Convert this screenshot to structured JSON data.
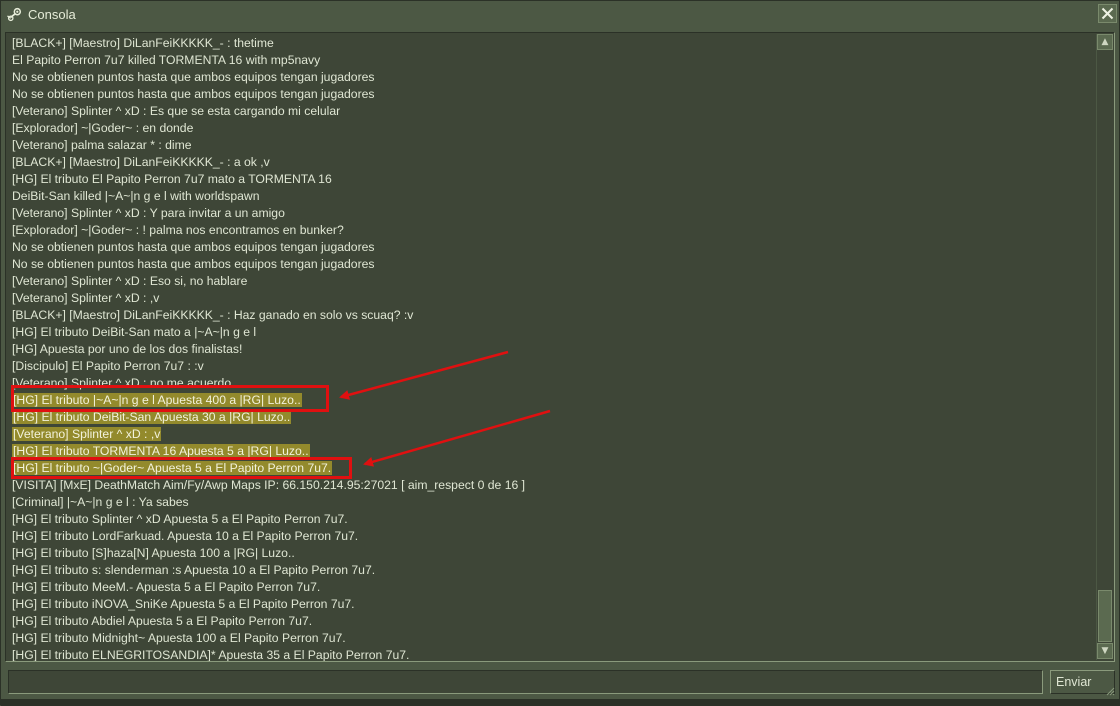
{
  "window": {
    "title": "Consola",
    "close_glyph": "✕"
  },
  "console": {
    "lines": [
      {
        "text": "[BLACK+] [Maestro] DiLanFeiKKKKK_- : thetime",
        "hl": false
      },
      {
        "text": "El Papito Perron 7u7 killed TORMENTA 16 with mp5navy",
        "hl": false
      },
      {
        "text": "No se obtienen puntos hasta que ambos equipos tengan jugadores",
        "hl": false
      },
      {
        "text": "No se obtienen puntos hasta que ambos equipos tengan jugadores",
        "hl": false
      },
      {
        "text": "[Veterano] Splinter ^ xD : Es que se esta cargando mi celular",
        "hl": false
      },
      {
        "text": "[Explorador] ~|Goder~ : en donde",
        "hl": false
      },
      {
        "text": "[Veterano] palma salazar * : dime",
        "hl": false
      },
      {
        "text": "[BLACK+] [Maestro] DiLanFeiKKKKK_- : a ok ,v",
        "hl": false
      },
      {
        "text": "[HG] El tributo El Papito Perron 7u7 mato a TORMENTA 16",
        "hl": false
      },
      {
        "text": "DeiBit-San killed |~A~|n g e l with worldspawn",
        "hl": false
      },
      {
        "text": "[Veterano] Splinter ^ xD : Y para invitar a un amigo",
        "hl": false
      },
      {
        "text": "[Explorador] ~|Goder~ : ! palma nos encontramos en bunker?",
        "hl": false
      },
      {
        "text": "No se obtienen puntos hasta que ambos equipos tengan jugadores",
        "hl": false
      },
      {
        "text": "No se obtienen puntos hasta que ambos equipos tengan jugadores",
        "hl": false
      },
      {
        "text": "[Veterano] Splinter ^ xD : Eso si, no hablare",
        "hl": false
      },
      {
        "text": "[Veterano] Splinter ^ xD : ,v",
        "hl": false
      },
      {
        "text": "[BLACK+] [Maestro] DiLanFeiKKKKK_- : Haz ganado en solo vs scuaq? :v",
        "hl": false
      },
      {
        "text": "[HG] El tributo DeiBit-San mato a |~A~|n g e l",
        "hl": false
      },
      {
        "text": "[HG] Apuesta por uno de los dos finalistas!",
        "hl": false
      },
      {
        "text": "[Discipulo] El Papito Perron 7u7 : :v",
        "hl": false
      },
      {
        "text": "[Veterano] Splinter ^ xD : no me acuerdo",
        "hl": false
      },
      {
        "text": "[HG] El tributo |~A~|n g e l Apuesta 400 a |RG| Luzo..",
        "hl": true
      },
      {
        "text": "[HG] El tributo DeiBit-San Apuesta 30 a |RG| Luzo..",
        "hl": true
      },
      {
        "text": "[Veterano] Splinter ^ xD : ,v",
        "hl": true
      },
      {
        "text": "[HG] El tributo TORMENTA 16 Apuesta 5 a |RG| Luzo..",
        "hl": true
      },
      {
        "text": "[HG] El tributo ~|Goder~ Apuesta 5 a El Papito Perron 7u7.",
        "hl": true
      },
      {
        "text": "[VISITA] [MxE] DeathMatch Aim/Fy/Awp Maps IP: 66.150.214.95:27021 [ aim_respect 0 de 16 ]",
        "hl": false
      },
      {
        "text": "[Criminal] |~A~|n g e l : Ya sabes",
        "hl": false
      },
      {
        "text": "[HG] El tributo Splinter ^ xD Apuesta 5 a El Papito Perron 7u7.",
        "hl": false
      },
      {
        "text": "[HG] El tributo LordFarkuad. Apuesta 10 a El Papito Perron 7u7.",
        "hl": false
      },
      {
        "text": "[HG] El tributo [S]haza[N] Apuesta 100 a |RG| Luzo..",
        "hl": false
      },
      {
        "text": "[HG] El tributo s: slenderman :s Apuesta 10 a El Papito Perron 7u7.",
        "hl": false
      },
      {
        "text": "[HG] El tributo MeeM.- Apuesta 5 a El Papito Perron 7u7.",
        "hl": false
      },
      {
        "text": "[HG] El tributo iNOVA_SniKe Apuesta 5 a El Papito Perron 7u7.",
        "hl": false
      },
      {
        "text": "[HG] El tributo Abdiel Apuesta 5 a El Papito Perron 7u7.",
        "hl": false
      },
      {
        "text": "[HG] El tributo Midnight~ Apuesta 100 a El Papito Perron 7u7.",
        "hl": false
      },
      {
        "text": "[HG] El tributo ELNEGRITOSANDIA]* Apuesta 35 a El Papito Perron 7u7.",
        "hl": false
      }
    ]
  },
  "scrollbar": {
    "up_glyph": "▲",
    "down_glyph": "▼"
  },
  "input": {
    "value": "",
    "placeholder": ""
  },
  "send_button": {
    "label": "Enviar"
  },
  "colors": {
    "background": "#4c5844",
    "highlight": "#938a2c",
    "annotation": "#e01010"
  }
}
